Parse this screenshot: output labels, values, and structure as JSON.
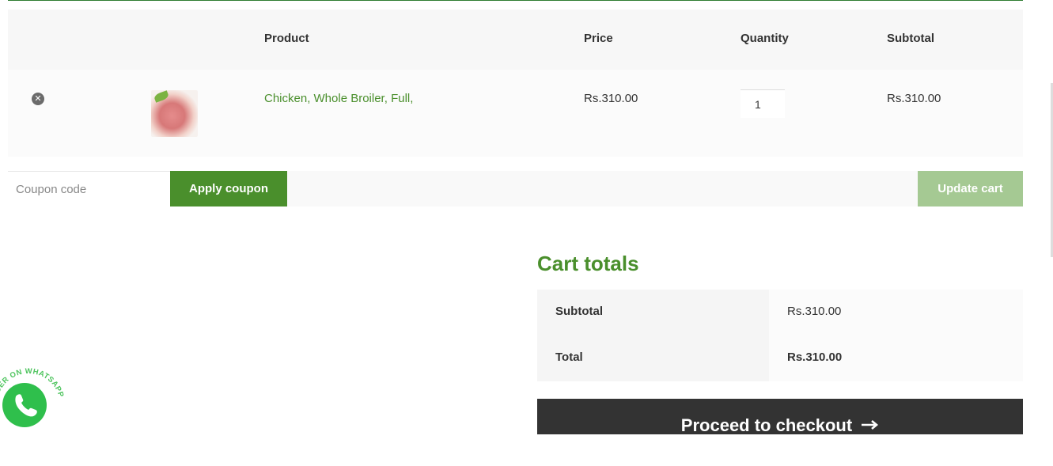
{
  "table": {
    "headers": {
      "product": "Product",
      "price": "Price",
      "quantity": "Quantity",
      "subtotal": "Subtotal"
    },
    "rows": [
      {
        "product": "Chicken, Whole Broiler, Full,",
        "price": "Rs.310.00",
        "quantity": "1",
        "subtotal": "Rs.310.00"
      }
    ]
  },
  "actions": {
    "coupon_placeholder": "Coupon code",
    "apply_label": "Apply coupon",
    "update_label": "Update cart"
  },
  "totals": {
    "title": "Cart totals",
    "subtotal_label": "Subtotal",
    "subtotal_value": "Rs.310.00",
    "total_label": "Total",
    "total_value": "Rs.310.00",
    "checkout_label": "Proceed to checkout"
  },
  "whatsapp": {
    "badge_text": "ORDER ON WHATSAPP"
  },
  "colors": {
    "brand_green": "#4a8f2c",
    "disabled_green": "#a5c993",
    "checkout_bg": "#333333"
  },
  "icons": {
    "remove": "close-circle-icon",
    "checkout_arrow": "arrow-right-icon",
    "whatsapp": "whatsapp-icon"
  }
}
